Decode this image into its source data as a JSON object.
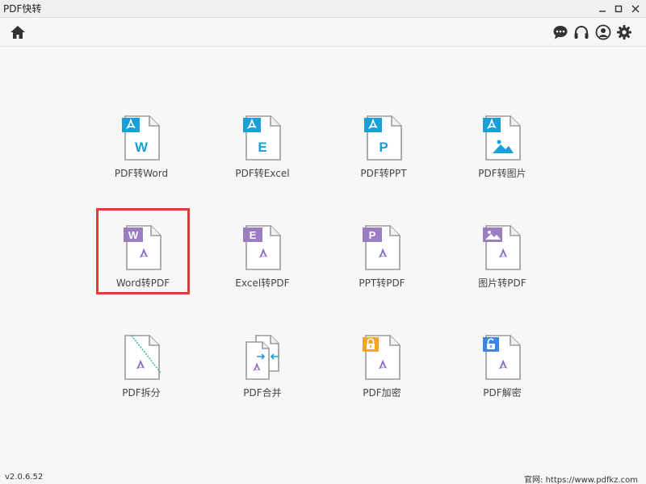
{
  "window": {
    "title": "PDF快转"
  },
  "toolbar": {
    "home_icon": "home-icon",
    "right_icons": [
      "chat-icon",
      "headset-icon",
      "user-icon",
      "gear-icon"
    ]
  },
  "colors": {
    "pdf_to_accent": "#1a9fd8",
    "to_pdf_accent": "#9b7ec2",
    "acrobat_mark": "#8b68c2",
    "lock_orange": "#f5a623",
    "unlock_blue": "#3a86e8",
    "selection_red": "#d9403a"
  },
  "tools": [
    {
      "label": "PDF转Word"
    },
    {
      "label": "PDF转Excel"
    },
    {
      "label": "PDF转PPT"
    },
    {
      "label": "PDF转图片"
    },
    {
      "label": "Word转PDF"
    },
    {
      "label": "Excel转PDF"
    },
    {
      "label": "PPT转PDF"
    },
    {
      "label": "图片转PDF"
    },
    {
      "label": "PDF拆分"
    },
    {
      "label": "PDF合并"
    },
    {
      "label": "PDF加密"
    },
    {
      "label": "PDF解密"
    }
  ],
  "tool_glyphs": {
    "pdf_to_word": "W",
    "pdf_to_excel": "E",
    "pdf_to_ppt": "P",
    "word_to_pdf": "W",
    "excel_to_pdf": "E",
    "ppt_to_pdf": "P"
  },
  "selected_tool": "Word转PDF",
  "status": {
    "version": "v2.0.6.52",
    "website": "官网:  https://www.pdfkz.com"
  }
}
